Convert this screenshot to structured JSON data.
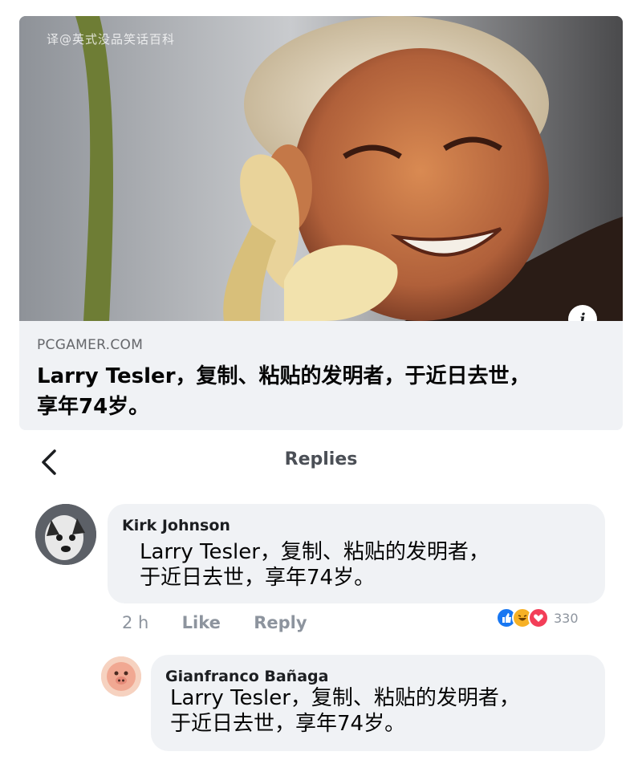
{
  "watermark": "译@英式没品笑话百科",
  "link_preview": {
    "domain": "PCGAMER.COM",
    "headline_line1": "Larry Tesler，复制、粘贴的发明者，于近日去世，",
    "headline_line2": "享年74岁。",
    "info_icon": "i"
  },
  "header": {
    "title": "Replies",
    "back_icon": "chevron-left-icon"
  },
  "comments": [
    {
      "author": "Kirk Johnson",
      "text_line1": "Larry Tesler，复制、粘贴的发明者，",
      "text_line2": "于近日去世，享年74岁。",
      "time": "2 h",
      "like_label": "Like",
      "reply_label": "Reply",
      "reaction_icons": [
        "like-icon",
        "haha-icon",
        "love-icon"
      ],
      "reaction_count": "330"
    },
    {
      "author": "Gianfranco Bañaga",
      "text_line1": "Larry Tesler，复制、粘贴的发明者，",
      "text_line2": "于近日去世，享年74岁。"
    }
  ],
  "colors": {
    "bubble": "#f0f2f5",
    "like": "#1877f2",
    "haha": "#f7b125",
    "love": "#f33e58"
  }
}
